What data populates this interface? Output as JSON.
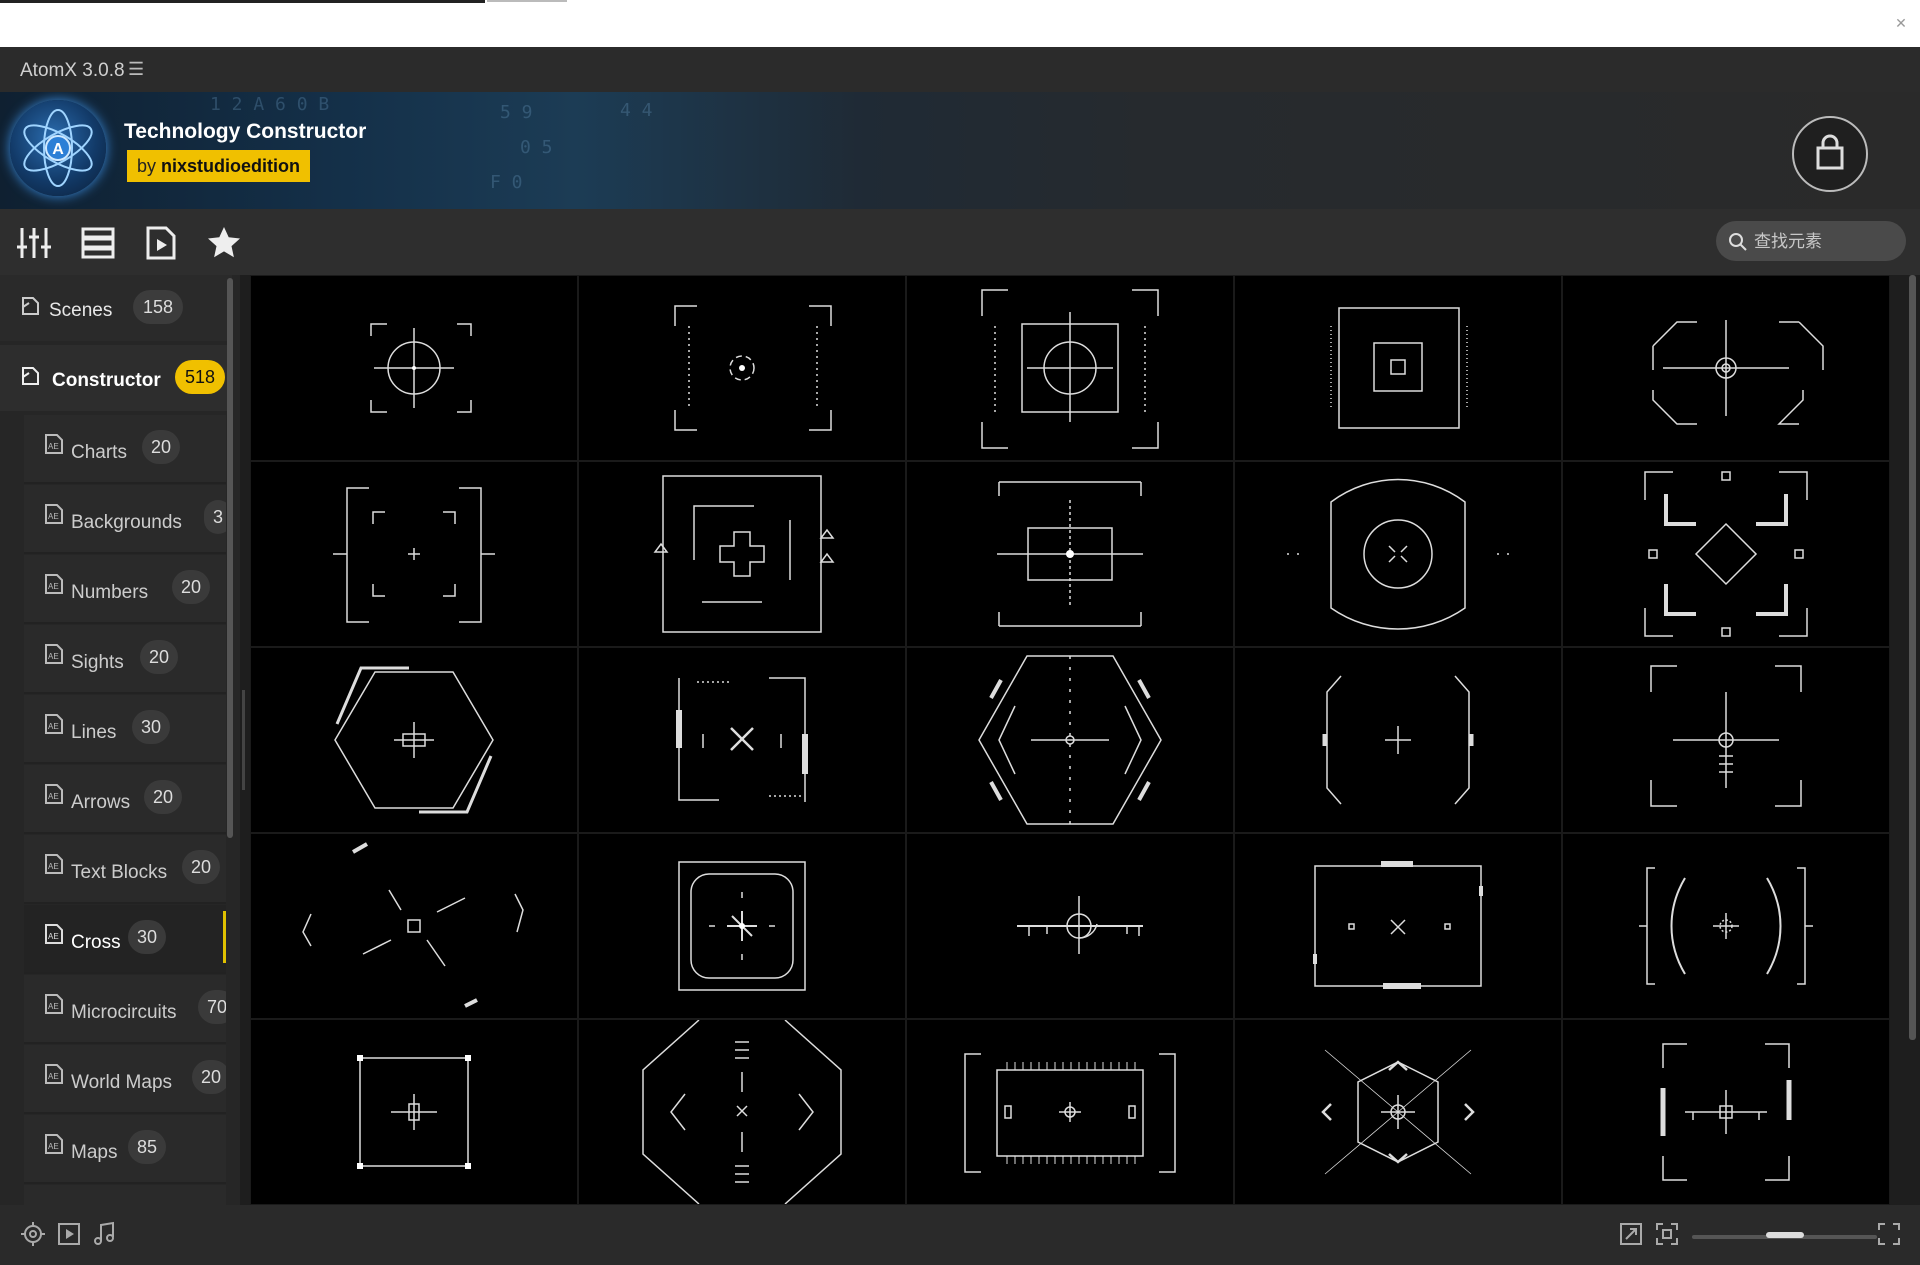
{
  "app": {
    "title": "AtomX 3.0.8",
    "menu_icon": "hamburger-icon"
  },
  "banner": {
    "pack_title": "Technology Constructor",
    "author_prefix": "by",
    "author_name": "nixstudioedition",
    "logo_letter": "A",
    "accent_color": "#f0c000"
  },
  "toolbar": {
    "tools": [
      "sliders-icon",
      "list-icon",
      "media-file-icon",
      "star-icon"
    ],
    "search_placeholder": "查找元素"
  },
  "sidebar": {
    "categories": [
      {
        "label": "Scenes",
        "count": "158",
        "active": false
      },
      {
        "label": "Constructor",
        "count": "518",
        "active": true
      }
    ],
    "subcategories": [
      {
        "label": "Charts",
        "count": "20"
      },
      {
        "label": "Backgrounds",
        "count": "3"
      },
      {
        "label": "Numbers",
        "count": "20"
      },
      {
        "label": "Sights",
        "count": "20"
      },
      {
        "label": "Lines",
        "count": "30"
      },
      {
        "label": "Arrows",
        "count": "20"
      },
      {
        "label": "Text Blocks",
        "count": "20"
      },
      {
        "label": "Cross",
        "count": "30",
        "active": true
      },
      {
        "label": "Microcircuits",
        "count": "70"
      },
      {
        "label": "World Maps",
        "count": "20"
      },
      {
        "label": "Maps",
        "count": "85"
      }
    ]
  },
  "grid": {
    "columns": 5,
    "rows_visible": 5,
    "item_type": "cross-thumbnail"
  },
  "bottombar": {
    "left_icons": [
      "target-icon",
      "play-box-icon",
      "music-note-icon"
    ],
    "right_icons": [
      "resize-icon",
      "fit-frame-icon",
      "fullscreen-icon"
    ],
    "zoom_level": 0.5
  }
}
